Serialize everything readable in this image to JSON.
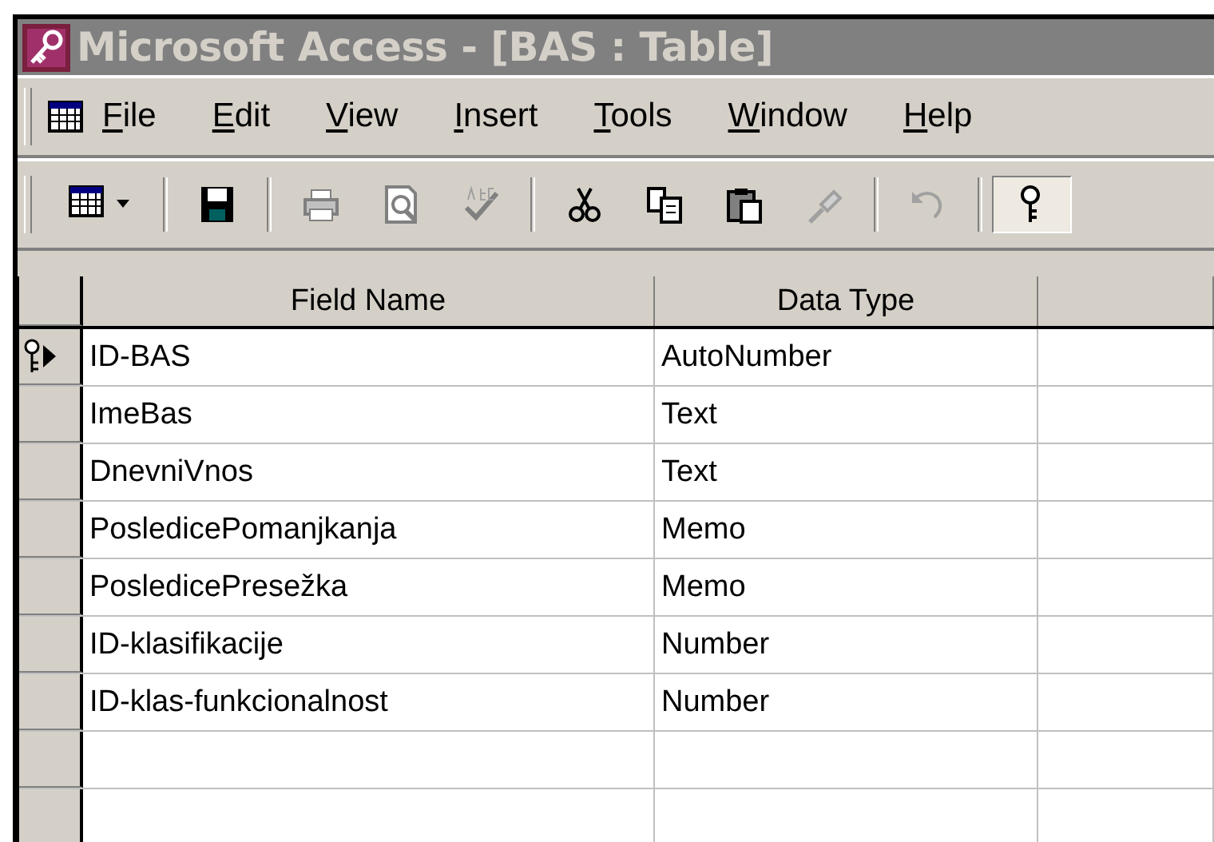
{
  "window": {
    "title": "Microsoft Access - [BAS : Table]",
    "active": false
  },
  "menu": [
    "File",
    "Edit",
    "View",
    "Insert",
    "Tools",
    "Window",
    "Help"
  ],
  "toolbar": [
    {
      "kind": "view",
      "pressed": false
    },
    {
      "kind": "sep"
    },
    {
      "kind": "save",
      "pressed": false
    },
    {
      "kind": "sep"
    },
    {
      "kind": "print",
      "pressed": false
    },
    {
      "kind": "preview",
      "pressed": false
    },
    {
      "kind": "spelling",
      "pressed": false
    },
    {
      "kind": "sep"
    },
    {
      "kind": "cut",
      "pressed": false
    },
    {
      "kind": "copy",
      "pressed": false
    },
    {
      "kind": "paste",
      "pressed": false
    },
    {
      "kind": "painter",
      "pressed": false
    },
    {
      "kind": "sep"
    },
    {
      "kind": "undo",
      "pressed": false
    },
    {
      "kind": "sep"
    },
    {
      "kind": "key",
      "pressed": true
    }
  ],
  "table": {
    "columns": [
      "Field Name",
      "Data Type"
    ],
    "rows": [
      {
        "field_name": "ID-BAS",
        "data_type": "AutoNumber",
        "primary_key": true,
        "current": true
      },
      {
        "field_name": "ImeBas",
        "data_type": "Text",
        "primary_key": false,
        "current": false
      },
      {
        "field_name": "DnevniVnos",
        "data_type": "Text",
        "primary_key": false,
        "current": false
      },
      {
        "field_name": "PosledicePomanjkanja",
        "data_type": "Memo",
        "primary_key": false,
        "current": false
      },
      {
        "field_name": "PosledicePresežka",
        "data_type": "Memo",
        "primary_key": false,
        "current": false
      },
      {
        "field_name": "ID-klasifikacije",
        "data_type": "Number",
        "primary_key": false,
        "current": false
      },
      {
        "field_name": "ID-klas-funkcionalnost",
        "data_type": "Number",
        "primary_key": false,
        "current": false
      },
      {
        "primary_key": false,
        "current": false
      },
      {
        "primary_key": false,
        "current": false
      }
    ]
  }
}
